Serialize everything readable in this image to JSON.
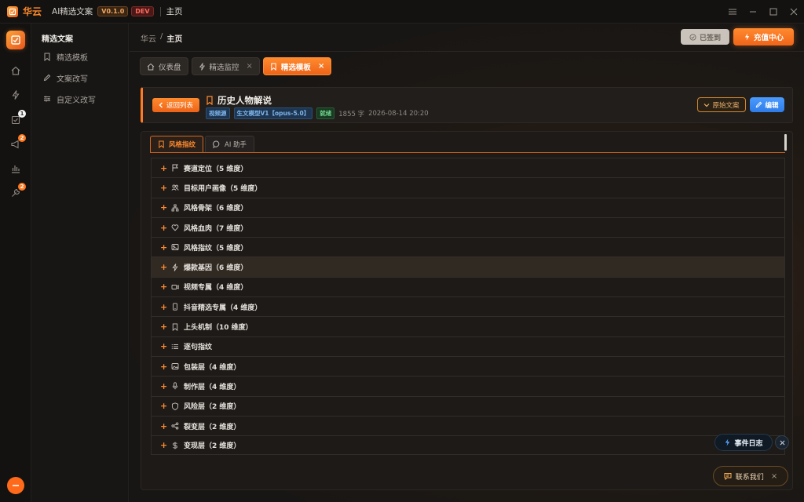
{
  "app": {
    "brand": "华云",
    "name": "AI精选文案",
    "version": "V0.1.0",
    "env": "DEV",
    "current_page": "主页"
  },
  "rail": {
    "items": [
      {
        "name": "home-icon"
      },
      {
        "name": "lightning-icon"
      },
      {
        "name": "check-square-icon",
        "badge": "1"
      },
      {
        "name": "megaphone-icon",
        "badge": "2"
      },
      {
        "name": "bar-chart-icon"
      },
      {
        "name": "wrench-icon",
        "badge": "2"
      }
    ]
  },
  "sidebar": {
    "title": "精选文案",
    "items": [
      {
        "label": "精选模板",
        "icon": "bookmark-icon"
      },
      {
        "label": "文案改写",
        "icon": "edit-icon"
      },
      {
        "label": "自定义改写",
        "icon": "sliders-icon"
      }
    ]
  },
  "header": {
    "breadcrumb": [
      "华云",
      "/",
      "主页"
    ],
    "signed_label": "已签到",
    "recharge_label": "充值中心"
  },
  "tabs": [
    {
      "label": "仪表盘",
      "icon": "home-icon",
      "closable": false
    },
    {
      "label": "精选监控",
      "icon": "lightning-icon",
      "closable": true
    },
    {
      "label": "精选模板",
      "icon": "bookmark-icon",
      "closable": true,
      "active": true
    }
  ],
  "doc": {
    "back_label": "返回列表",
    "title": "历史人物解说",
    "tags": [
      "视频源",
      "生文模型V1【opus-5.0】",
      "就绪"
    ],
    "word_count": "1855 字",
    "timestamp": "2026-08-14 20:20",
    "original_label": "原始文案",
    "edit_label": "编辑"
  },
  "panel": {
    "tabs": [
      {
        "label": "风格指纹",
        "active": true
      },
      {
        "label": "AI 助手"
      }
    ],
    "sections": [
      {
        "label": "赛道定位（5 维度）",
        "icon": "flag-icon"
      },
      {
        "label": "目标用户画像（5 维度）",
        "icon": "users-icon"
      },
      {
        "label": "风格骨架（6 维度）",
        "icon": "hierarchy-icon"
      },
      {
        "label": "风格血肉（7 维度）",
        "icon": "heart-icon"
      },
      {
        "label": "风格指纹（5 维度）",
        "icon": "image-frame-icon"
      },
      {
        "label": "爆款基因（6 维度）",
        "icon": "lightning-icon",
        "highlighted": true
      },
      {
        "label": "视频专属（4 维度）",
        "icon": "video-icon"
      },
      {
        "label": "抖音精选专属（4 维度）",
        "icon": "phone-icon"
      },
      {
        "label": "上头机制（10 维度）",
        "icon": "bookmark-icon"
      },
      {
        "label": "逐句指纹",
        "icon": "list-icon"
      },
      {
        "label": "包装层（4 维度）",
        "icon": "picture-icon"
      },
      {
        "label": "制作层（4 维度）",
        "icon": "mic-icon"
      },
      {
        "label": "风险层（2 维度）",
        "icon": "shield-icon"
      },
      {
        "label": "裂变层（2 维度）",
        "icon": "share-icon"
      },
      {
        "label": "变现层（2 维度）",
        "icon": "dollar-icon"
      }
    ]
  },
  "floating": {
    "event_log_label": "事件日志",
    "contact_label": "联系我们"
  },
  "colors": {
    "accent": "#ff7a24",
    "edit_blue": "#2f7ce8",
    "background": "#161514"
  }
}
